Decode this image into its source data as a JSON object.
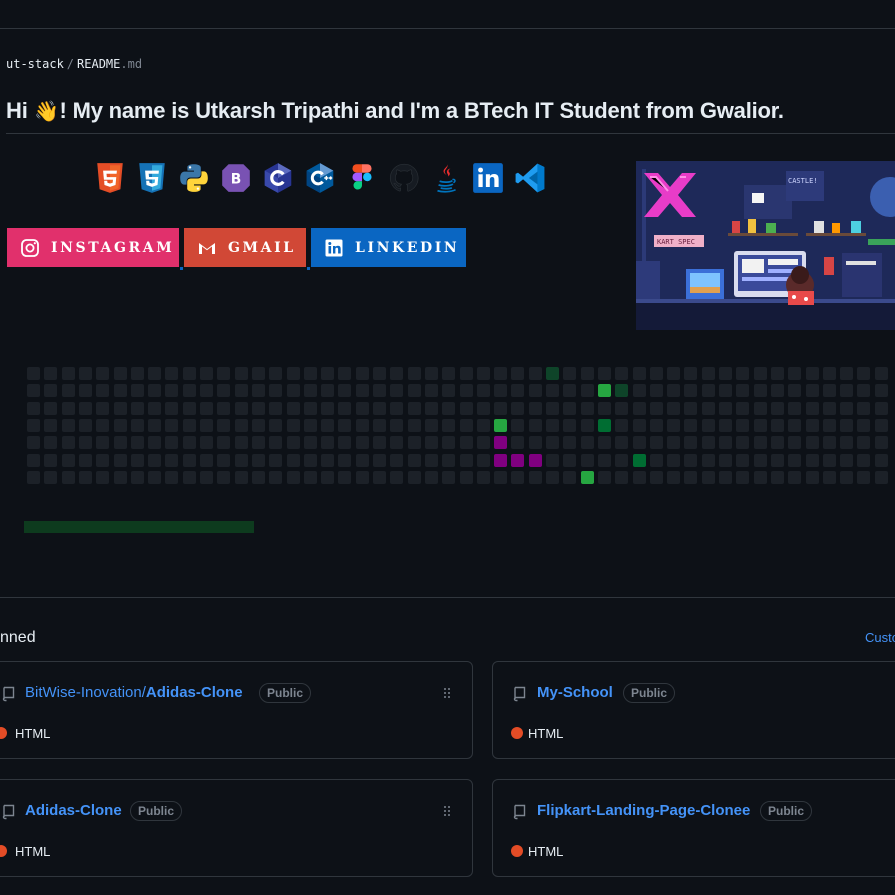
{
  "breadcrumb": {
    "repo": "ut-stack",
    "separator": "/",
    "file": "README",
    "ext": ".md"
  },
  "headline": {
    "greeting": "Hi",
    "wave": "👋",
    "text": "! My name is Utkarsh Tripathi and I'm a BTech IT Student from Gwalior."
  },
  "tech_icons": [
    "html5-icon",
    "css3-icon",
    "python-icon",
    "bootstrap-icon",
    "c-icon",
    "cplusplus-icon",
    "figma-icon",
    "github-icon",
    "java-icon",
    "linkedin-icon",
    "vscode-icon"
  ],
  "social": {
    "instagram": {
      "label": "INSTAGRAM",
      "color": "#e1306c"
    },
    "gmail": {
      "label": "GMAIL",
      "color": "#d14836"
    },
    "linkedin": {
      "label": "LINKEDIN",
      "color": "#0a66c2"
    }
  },
  "contribution_grid": {
    "columns": 51,
    "rows": 7,
    "empty_color": "#1c2128",
    "highlights": [
      {
        "col": 30,
        "row": 0,
        "color": "#0e4429"
      },
      {
        "col": 33,
        "row": 1,
        "color": "#26a641"
      },
      {
        "col": 34,
        "row": 1,
        "color": "#0e4429"
      },
      {
        "col": 27,
        "row": 3,
        "color": "#26a641"
      },
      {
        "col": 33,
        "row": 3,
        "color": "#006d32"
      },
      {
        "col": 27,
        "row": 4,
        "color": "#800080"
      },
      {
        "col": 27,
        "row": 5,
        "color": "#800080"
      },
      {
        "col": 28,
        "row": 5,
        "color": "#800080"
      },
      {
        "col": 29,
        "row": 5,
        "color": "#800080"
      },
      {
        "col": 35,
        "row": 5,
        "color": "#006d32"
      },
      {
        "col": 32,
        "row": 6,
        "color": "#26a641"
      }
    ]
  },
  "pinned": {
    "title": "nned",
    "customize": "Custo",
    "cards": [
      {
        "owner": "BitWise-Inovation/",
        "name": "Adidas-Clone",
        "visibility": "Public",
        "language": "HTML",
        "lang_color": "#e34c26"
      },
      {
        "owner": "",
        "name": "My-School",
        "visibility": "Public",
        "language": "HTML",
        "lang_color": "#e34c26"
      },
      {
        "owner": "",
        "name": "Adidas-Clone",
        "visibility": "Public",
        "language": "HTML",
        "lang_color": "#e34c26"
      },
      {
        "owner": "",
        "name": "Flipkart-Landing-Page-Clonee",
        "visibility": "Public",
        "language": "HTML",
        "lang_color": "#e34c26"
      }
    ]
  }
}
